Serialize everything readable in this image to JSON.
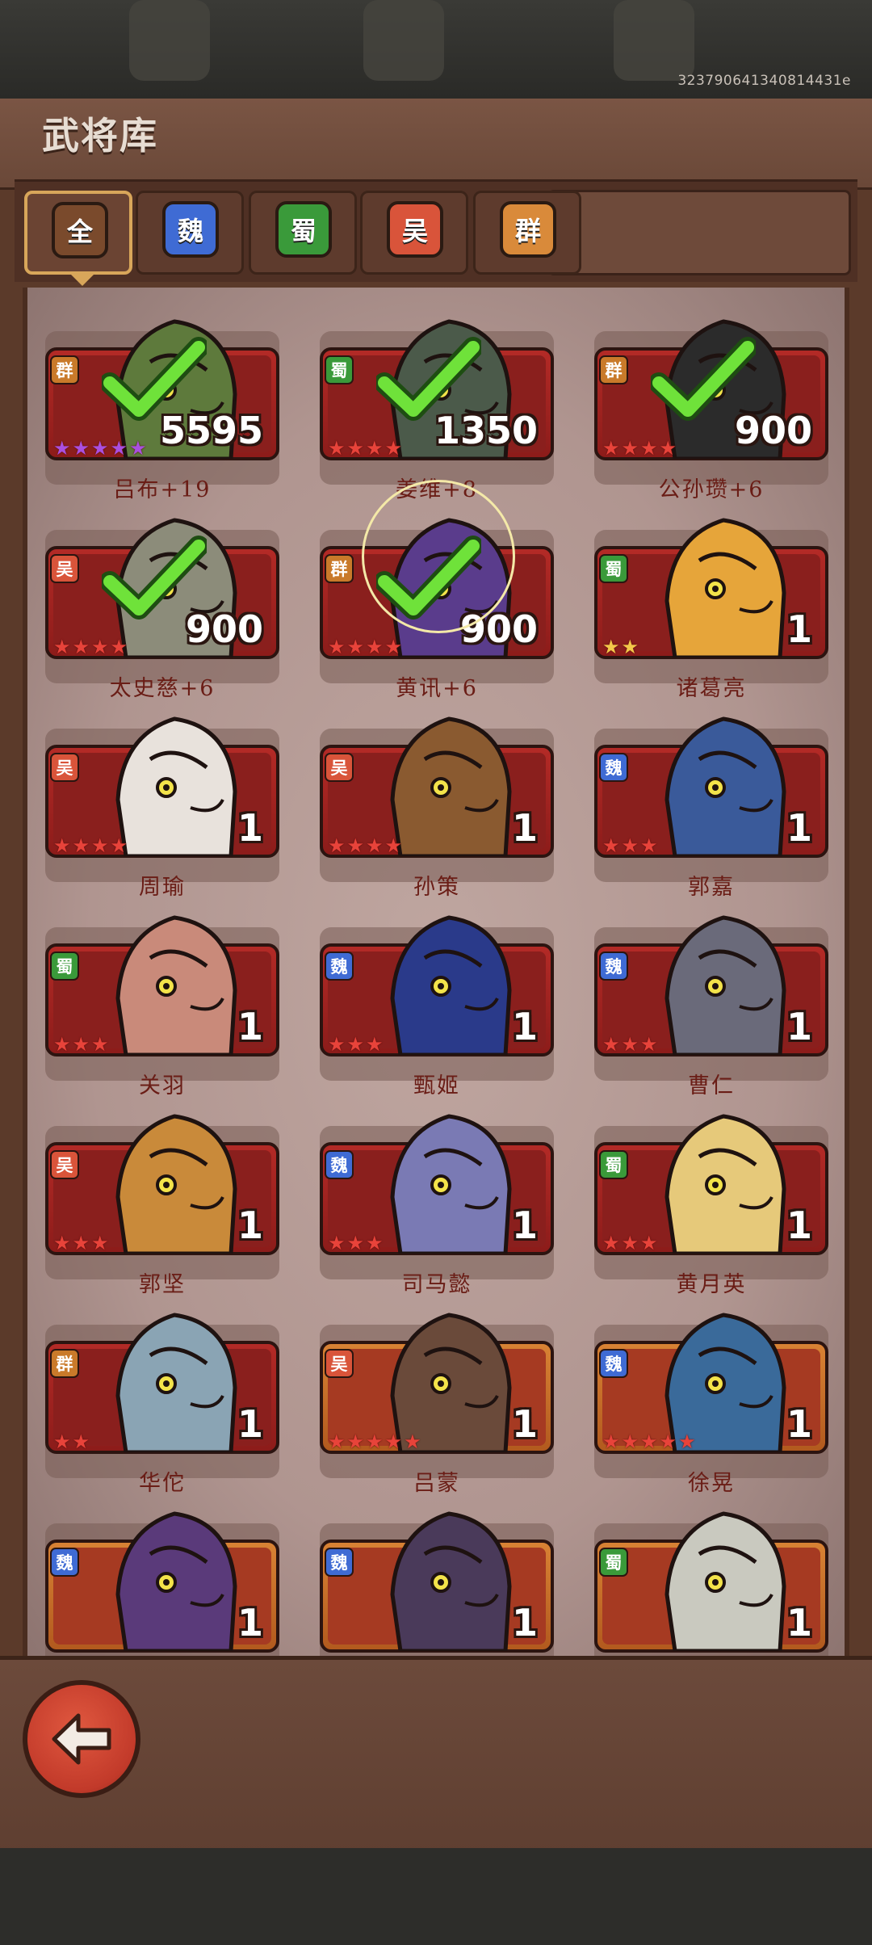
{
  "uid": "323790641340814431e",
  "title": "武将库",
  "tabs": [
    {
      "label": "全",
      "color": "#7a4a2c",
      "active": true
    },
    {
      "label": "魏",
      "color": "#3f6bd4",
      "active": false
    },
    {
      "label": "蜀",
      "color": "#3a9a3a",
      "active": false
    },
    {
      "label": "吴",
      "color": "#d9543a",
      "active": false
    },
    {
      "label": "群",
      "color": "#d98a3a",
      "active": false
    }
  ],
  "faction_colors": {
    "群": "#c97a2a",
    "蜀": "#3a9a3a",
    "吴": "#d9543a",
    "魏": "#3f6bd4"
  },
  "cards": [
    {
      "faction": "群",
      "power": "5595",
      "name": "吕布+19",
      "stars": 5,
      "star_color": "purple",
      "selected": true,
      "plate": "red",
      "portrait_color": "#5e7a3c",
      "icon": "frog-icon"
    },
    {
      "faction": "蜀",
      "power": "1350",
      "name": "姜维+8",
      "stars": 4,
      "star_color": "red",
      "selected": true,
      "plate": "red",
      "portrait_color": "#4b5a4a",
      "icon": "shark-icon"
    },
    {
      "faction": "群",
      "power": "900",
      "name": "公孙瓒+6",
      "stars": 4,
      "star_color": "red",
      "selected": true,
      "plate": "red",
      "portrait_color": "#2b2b2b",
      "icon": "bird-icon"
    },
    {
      "faction": "吴",
      "power": "900",
      "name": "太史慈+6",
      "stars": 4,
      "star_color": "red",
      "selected": true,
      "plate": "red",
      "portrait_color": "#8c8c7a",
      "icon": "rhino-icon"
    },
    {
      "faction": "群",
      "power": "900",
      "name": "黄讯+6",
      "stars": 4,
      "star_color": "red",
      "selected": true,
      "plate": "red",
      "portrait_color": "#5a3c8c",
      "icon": "jester-icon"
    },
    {
      "faction": "蜀",
      "power": "1",
      "name": "诸葛亮",
      "stars": 2,
      "star_color": "gold",
      "selected": false,
      "plate": "red",
      "portrait_color": "#e6a53a",
      "icon": "warrior-icon"
    },
    {
      "faction": "吴",
      "power": "1",
      "name": "周瑜",
      "stars": 4,
      "star_color": "red",
      "selected": false,
      "plate": "red",
      "portrait_color": "#e8e2dc",
      "icon": "horse-icon"
    },
    {
      "faction": "吴",
      "power": "1",
      "name": "孙策",
      "stars": 4,
      "star_color": "red",
      "selected": false,
      "plate": "red",
      "portrait_color": "#8a5a30",
      "icon": "warrior-icon"
    },
    {
      "faction": "魏",
      "power": "1",
      "name": "郭嘉",
      "stars": 3,
      "star_color": "red",
      "selected": false,
      "plate": "red",
      "portrait_color": "#3a5a9a",
      "icon": "shark-icon"
    },
    {
      "faction": "蜀",
      "power": "1",
      "name": "关羽",
      "stars": 3,
      "star_color": "red",
      "selected": false,
      "plate": "red",
      "portrait_color": "#c98a7a",
      "icon": "pig-icon"
    },
    {
      "faction": "魏",
      "power": "1",
      "name": "甄姬",
      "stars": 3,
      "star_color": "red",
      "selected": false,
      "plate": "red",
      "portrait_color": "#2a3a8a",
      "icon": "lady-icon"
    },
    {
      "faction": "魏",
      "power": "1",
      "name": "曹仁",
      "stars": 3,
      "star_color": "red",
      "selected": false,
      "plate": "red",
      "portrait_color": "#6a6a7a",
      "icon": "whale-icon"
    },
    {
      "faction": "吴",
      "power": "1",
      "name": "郭坚",
      "stars": 3,
      "star_color": "red",
      "selected": false,
      "plate": "red",
      "portrait_color": "#c98a3a",
      "icon": "boar-icon"
    },
    {
      "faction": "魏",
      "power": "1",
      "name": "司马懿",
      "stars": 3,
      "star_color": "red",
      "selected": false,
      "plate": "red",
      "portrait_color": "#7a7ab4",
      "icon": "rabbit-icon"
    },
    {
      "faction": "蜀",
      "power": "1",
      "name": "黄月英",
      "stars": 3,
      "star_color": "red",
      "selected": false,
      "plate": "red",
      "portrait_color": "#e6c97a",
      "icon": "lady-icon"
    },
    {
      "faction": "群",
      "power": "1",
      "name": "华佗",
      "stars": 2,
      "star_color": "red",
      "selected": false,
      "plate": "red",
      "portrait_color": "#8aa4b4",
      "icon": "fish-icon"
    },
    {
      "faction": "吴",
      "power": "1",
      "name": "吕蒙",
      "stars": 5,
      "star_color": "red",
      "selected": false,
      "plate": "gold",
      "portrait_color": "#6a4a3a",
      "icon": "goat-icon"
    },
    {
      "faction": "魏",
      "power": "1",
      "name": "徐晃",
      "stars": 5,
      "star_color": "red",
      "selected": false,
      "plate": "gold",
      "portrait_color": "#3a6a9a",
      "icon": "wolf-icon"
    },
    {
      "faction": "魏",
      "power": "1",
      "name": "",
      "stars": 0,
      "star_color": "red",
      "selected": false,
      "plate": "gold",
      "portrait_color": "#5a3a7a",
      "icon": "mantis-icon"
    },
    {
      "faction": "魏",
      "power": "1",
      "name": "",
      "stars": 0,
      "star_color": "red",
      "selected": false,
      "plate": "gold",
      "portrait_color": "#4a3a5a",
      "icon": "warrior-icon"
    },
    {
      "faction": "蜀",
      "power": "1",
      "name": "",
      "stars": 0,
      "star_color": "red",
      "selected": false,
      "plate": "gold",
      "portrait_color": "#c9c9bf",
      "icon": "goat-icon"
    }
  ],
  "back_button": {
    "icon": "back-arrow-icon"
  }
}
